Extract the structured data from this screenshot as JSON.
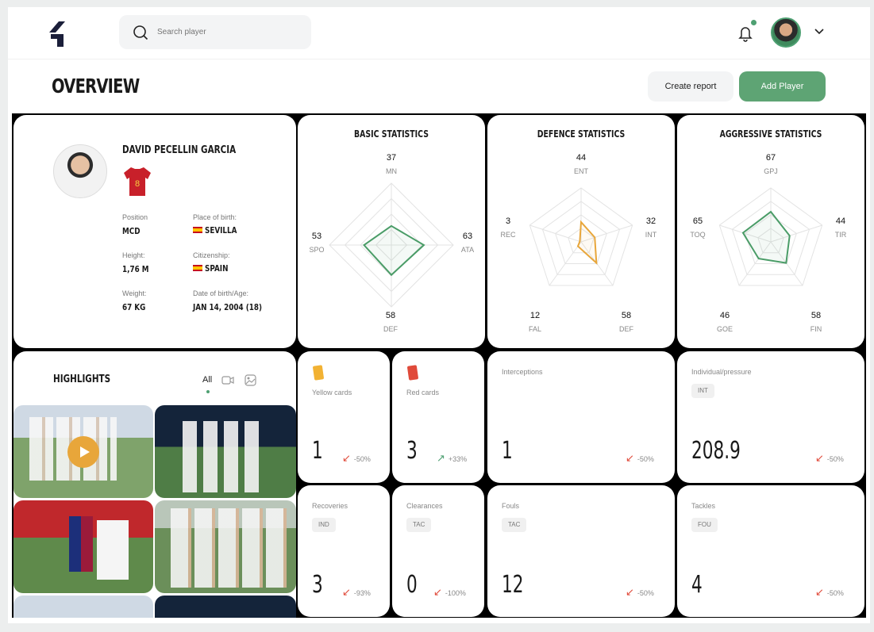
{
  "header": {
    "search_placeholder": "Search player",
    "notification_icon": "bell-icon",
    "user_menu_icon": "chevron-down-icon"
  },
  "page": {
    "title": "OVERVIEW",
    "create_report_label": "Create report",
    "add_player_label": "Add  Player"
  },
  "player": {
    "name": "DAVID PECELLIN GARCIA",
    "shirt_number": "8",
    "position_label": "Position",
    "position": "MCD",
    "birthplace_label": "Place of birth:",
    "birthplace": "SEVILLA",
    "height_label": "Height:",
    "height": "1,76 M",
    "citizenship_label": "Citizenship:",
    "citizenship": "SPAIN",
    "weight_label": "Weight:",
    "weight": "67 KG",
    "dob_label": "Date of birth/Age:",
    "dob": "JAN 14, 2004 (18)"
  },
  "radars": [
    {
      "title": "BASIC STATISTICS",
      "color": "#4a9c67",
      "axes": [
        {
          "label": "MN",
          "value": "37"
        },
        {
          "label": "ATA",
          "value": "63"
        },
        {
          "label": "DEF",
          "value": "58"
        },
        {
          "label": "SPO",
          "value": "53"
        }
      ]
    },
    {
      "title": "DEFENCE STATISTICS",
      "color": "#e8a63a",
      "axes": [
        {
          "label": "ENT",
          "value": "44"
        },
        {
          "label": "INT",
          "value": "32"
        },
        {
          "label": "DEF",
          "value": "58"
        },
        {
          "label": "FAL",
          "value": "12"
        },
        {
          "label": "REC",
          "value": "3"
        }
      ]
    },
    {
      "title": "AGGRESSIVE STATISTICS",
      "color": "#4a9c67",
      "axes": [
        {
          "label": "GPJ",
          "value": "67"
        },
        {
          "label": "TIR",
          "value": "44"
        },
        {
          "label": "FIN",
          "value": "58"
        },
        {
          "label": "GOE",
          "value": "46"
        },
        {
          "label": "TOQ",
          "value": "65"
        }
      ]
    }
  ],
  "highlights": {
    "title": "HIGHLIGHTS",
    "filter_all": "All",
    "video_filter_icon": "video-icon",
    "image_filter_icon": "image-icon"
  },
  "stats": {
    "yellow": {
      "label": "Yellow cards",
      "value": "1",
      "delta": "-50%",
      "trend": "down",
      "icon": "yellow-card-icon"
    },
    "red": {
      "label": "Red cards",
      "value": "3",
      "delta": "+33%",
      "trend": "up",
      "icon": "red-card-icon"
    },
    "interceptions": {
      "label": "Interceptions",
      "value": "1",
      "delta": "-50%",
      "trend": "down"
    },
    "pressure": {
      "label": "Individual/pressure",
      "tag": "INT",
      "value": "208.9",
      "delta": "-50%",
      "trend": "down"
    },
    "recoveries": {
      "label": "Recoveries",
      "tag": "IND",
      "value": "3",
      "delta": "-93%",
      "trend": "down"
    },
    "clearances": {
      "label": "Clearances",
      "tag": "TAC",
      "value": "0",
      "delta": "-100%",
      "trend": "down"
    },
    "fouls": {
      "label": "Fouls",
      "tag": "TAC",
      "value": "12",
      "delta": "-50%",
      "trend": "down"
    },
    "tackles": {
      "label": "Tackles",
      "tag": "FOU",
      "value": "4",
      "delta": "-50%",
      "trend": "down"
    }
  },
  "colors": {
    "accent": "#5ea474",
    "down": "#e04a3a",
    "up": "#4ea072"
  }
}
